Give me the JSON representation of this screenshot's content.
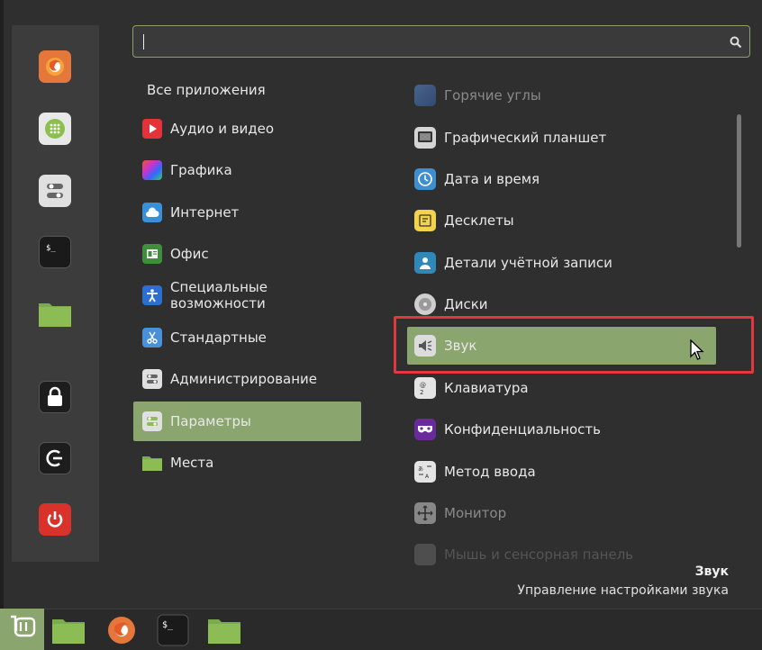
{
  "search": {
    "value": "",
    "placeholder": ""
  },
  "favorites": [
    {
      "name": "firefox"
    },
    {
      "name": "software-manager"
    },
    {
      "name": "system-settings"
    },
    {
      "name": "terminal"
    },
    {
      "name": "files"
    },
    {
      "name": "lock-screen"
    },
    {
      "name": "logout"
    },
    {
      "name": "shutdown"
    }
  ],
  "categories": {
    "all": "Все приложения",
    "items": [
      {
        "label": "Аудио и видео"
      },
      {
        "label": "Графика"
      },
      {
        "label": "Интернет"
      },
      {
        "label": "Офис"
      },
      {
        "label": "Специальные возможности"
      },
      {
        "label": "Стандартные"
      },
      {
        "label": "Администрирование"
      },
      {
        "label": "Параметры"
      },
      {
        "label": "Места"
      }
    ]
  },
  "apps": [
    {
      "label": "Горячие углы"
    },
    {
      "label": "Графический планшет"
    },
    {
      "label": "Дата и время"
    },
    {
      "label": "Десклеты"
    },
    {
      "label": "Детали учётной записи"
    },
    {
      "label": "Диски"
    },
    {
      "label": "Звук"
    },
    {
      "label": "Клавиатура"
    },
    {
      "label": "Конфиденциальность"
    },
    {
      "label": "Метод ввода"
    },
    {
      "label": "Монитор"
    },
    {
      "label": "Мышь и сенсорная панель"
    }
  ],
  "description": {
    "title": "Звук",
    "text": "Управление настройками звука"
  },
  "colors": {
    "accent": "#8aa56d",
    "highlight_box": "#e1373d"
  }
}
